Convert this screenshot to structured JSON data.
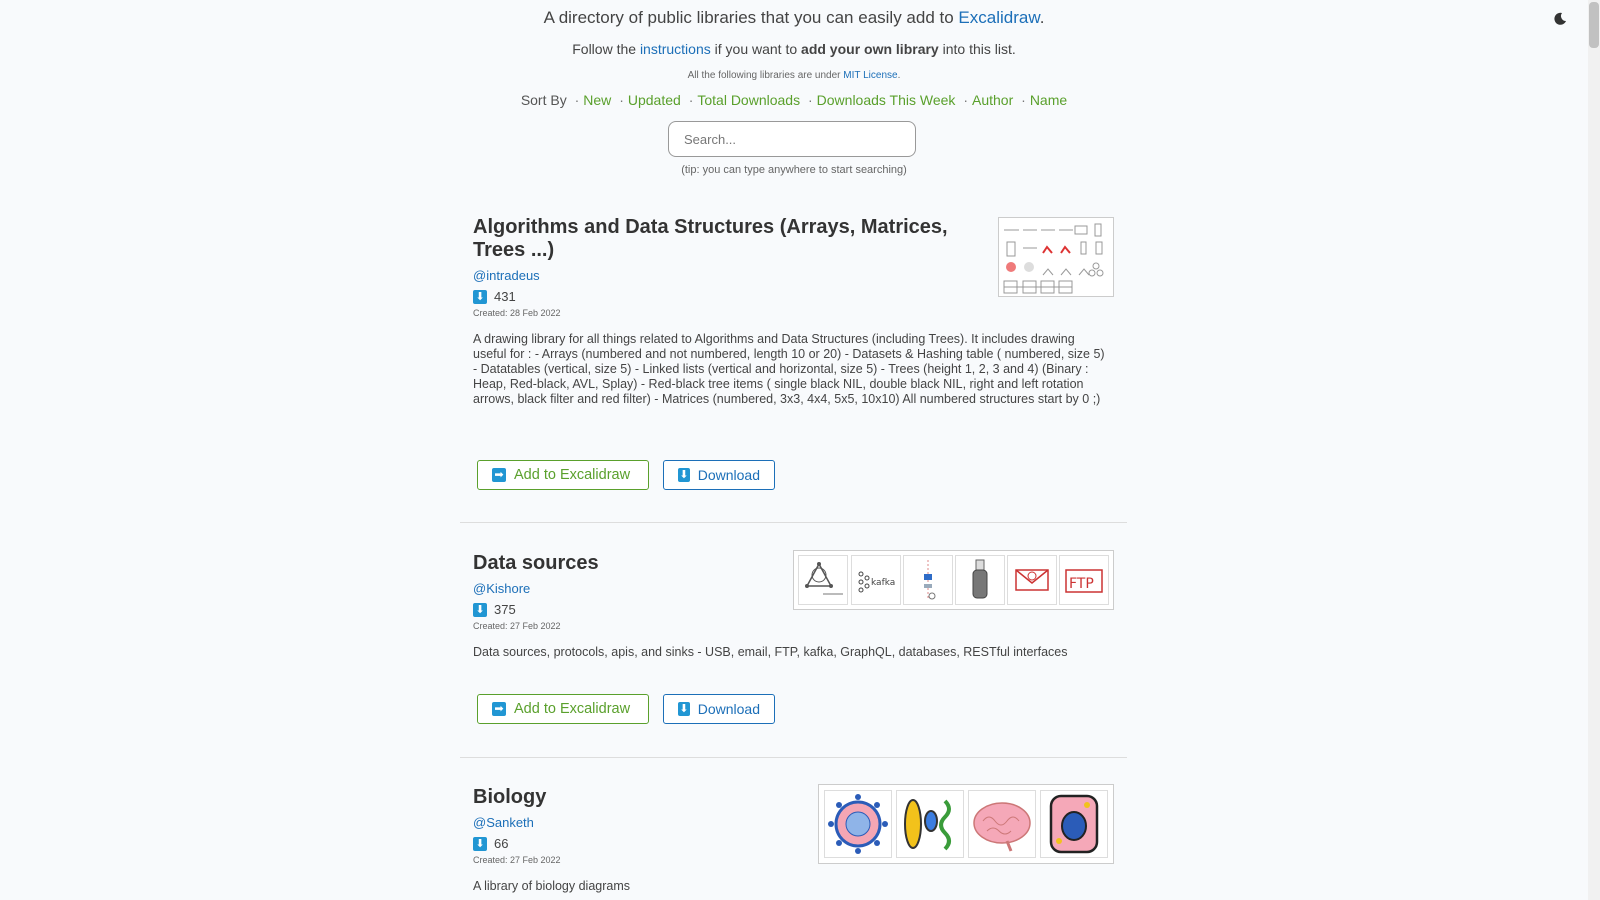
{
  "header": {
    "intro_prefix": "A directory of public libraries that you can easily add to ",
    "intro_link": "Excalidraw",
    "intro_suffix": ".",
    "follow_prefix": "Follow the ",
    "follow_link": "instructions",
    "follow_middle": " if you want to ",
    "follow_bold": "add your own library",
    "follow_suffix": " into this list.",
    "license_prefix": "All the following libraries are under ",
    "license_link": "MIT License",
    "license_suffix": ".",
    "sort_label": "Sort By",
    "sort_options": [
      "New",
      "Updated",
      "Total Downloads",
      "Downloads This Week",
      "Author",
      "Name"
    ],
    "sep": "·",
    "search_placeholder": "Search...",
    "tip": "(tip: you can type anywhere to start searching)"
  },
  "libraries": [
    {
      "title": "Algorithms and Data Structures (Arrays, Matrices, Trees ...)",
      "author": "@intradeus",
      "downloads": "431",
      "created": "Created: 28 Feb 2022",
      "description": "A drawing library for all things related to Algorithms and Data Structures (including Trees). It includes drawing useful for : - Arrays (numbered and not numbered, length 10 or 20) - Datasets & Hashing table ( numbered, size 5) - Datatables (vertical, size 5) - Linked lists (vertical and horizontal, size 5) - Trees (height 1, 2, 3 and 4) (Binary : Heap, Red-black, AVL, Splay) - Red-black tree items ( single black NIL, double black NIL, right and left rotation arrows, black filter and red filter) - Matrices (numbered, 3x3, 4x4, 5x5, 10x10) All numbered structures start by 0 ;)",
      "add_label": "Add to Excalidraw",
      "download_label": "Download"
    },
    {
      "title": "Data sources",
      "author": "@Kishore",
      "downloads": "375",
      "created": "Created: 27 Feb 2022",
      "description": "Data sources, protocols, apis, and sinks - USB, email, FTP, kafka, GraphQL, databases, RESTful interfaces",
      "add_label": "Add to Excalidraw",
      "download_label": "Download",
      "thumb_texts": [
        "kafka",
        "FTP"
      ]
    },
    {
      "title": "Biology",
      "author": "@Sanketh",
      "downloads": "66",
      "created": "Created: 27 Feb 2022",
      "description": "A library of biology diagrams"
    }
  ],
  "colors": {
    "link": "#1c6fb8",
    "sort_link": "#5aa02c",
    "add_button": "#5aa02c",
    "download_icon": "#2196d3"
  },
  "icons": {
    "theme_toggle": "moon-icon",
    "download": "download-arrow-icon",
    "add": "arrow-right-icon"
  }
}
